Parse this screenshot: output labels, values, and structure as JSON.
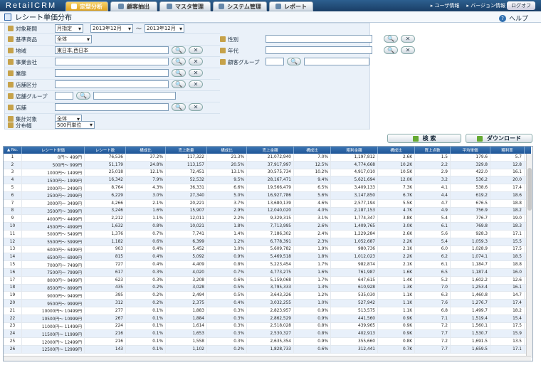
{
  "app": {
    "logo": "RetailCRM"
  },
  "nav": {
    "tabs": [
      {
        "label": "定型分析",
        "active": true
      },
      {
        "label": "顧客抽出",
        "active": false
      },
      {
        "label": "マスタ管理",
        "active": false
      },
      {
        "label": "システム管理",
        "active": false
      },
      {
        "label": "レポート",
        "active": false
      }
    ],
    "links": [
      "▸ ユーザ情報",
      "▸ バージョン情報"
    ],
    "logout": "ログオフ"
  },
  "page": {
    "title": "レシート単価分布",
    "help": "ヘルプ"
  },
  "filters": {
    "period_label": "対象期間",
    "period_mode": "月指定",
    "period_from": "2013年12月",
    "period_sep": "〜",
    "period_to": "2013年12月",
    "base_product_label": "基準商品",
    "base_product": "全体",
    "region_label": "地域",
    "region_value": "東日本,西日本",
    "company_label": "事業会社",
    "format_label": "業態",
    "store_type_label": "店舗区分",
    "store_group_label": "店舗グループ",
    "store_label": "店舗",
    "target_label": "集計対象",
    "target_value": "全体",
    "width_label": "分布幅",
    "width_value": "500円単位",
    "gender_label": "性別",
    "age_label": "年代",
    "customer_group_label": "顧客グループ",
    "search_glyph": "🔍",
    "clear_glyph": "✕"
  },
  "actions": {
    "search": "検 索",
    "download": "ダウンロード"
  },
  "table": {
    "headers": [
      "▲ No.",
      "レシート単価",
      "レシート数",
      "構成比",
      "売上数量",
      "構成比",
      "売上金額",
      "構成比",
      "粗利金額",
      "構成比",
      "買上点数",
      "平均単価",
      "粗利率"
    ],
    "rows": [
      [
        "1",
        "0円～ 499円",
        "76,536",
        "37.2%",
        "117,322",
        "21.3%",
        "21,072,940",
        "7.0%",
        "1,197,812",
        "2.6K",
        "1.5",
        "179.6",
        "5.7"
      ],
      [
        "2",
        "500円～ 999円",
        "51,179",
        "24.8%",
        "113,157",
        "20.5%",
        "37,917,997",
        "12.5%",
        "4,774,668",
        "10.2K",
        "2.2",
        "329.8",
        "12.8"
      ],
      [
        "3",
        "1000円～ 1499円",
        "25,018",
        "12.1%",
        "72,451",
        "13.1%",
        "30,575,734",
        "10.2%",
        "4,917,010",
        "10.5K",
        "2.9",
        "422.0",
        "16.1"
      ],
      [
        "4",
        "1500円～ 1999円",
        "16,342",
        "7.9%",
        "52,532",
        "9.5%",
        "28,167,471",
        "9.4%",
        "5,621,694",
        "12.0K",
        "3.2",
        "536.2",
        "20.0"
      ],
      [
        "5",
        "2000円～ 2499円",
        "8,764",
        "4.3%",
        "36,331",
        "6.6%",
        "19,566,479",
        "6.5%",
        "3,409,133",
        "7.3K",
        "4.1",
        "538.6",
        "17.4"
      ],
      [
        "6",
        "2500円～ 2999円",
        "6,229",
        "3.0%",
        "27,340",
        "5.0%",
        "16,927,786",
        "5.6%",
        "3,147,850",
        "6.7K",
        "4.4",
        "619.2",
        "18.6"
      ],
      [
        "7",
        "3000円～ 3499円",
        "4,266",
        "2.1%",
        "20,221",
        "3.7%",
        "13,680,139",
        "4.6%",
        "2,577,194",
        "5.5K",
        "4.7",
        "676.5",
        "18.8"
      ],
      [
        "8",
        "3500円～ 3999円",
        "3,246",
        "1.6%",
        "15,907",
        "2.9%",
        "12,040,020",
        "4.0%",
        "2,187,153",
        "4.7K",
        "4.9",
        "756.9",
        "18.2"
      ],
      [
        "9",
        "4000円～ 4499円",
        "2,212",
        "1.1%",
        "12,011",
        "2.2%",
        "9,329,315",
        "3.1%",
        "1,774,347",
        "3.8K",
        "5.4",
        "776.7",
        "19.0"
      ],
      [
        "10",
        "4500円～ 4999円",
        "1,632",
        "0.8%",
        "10,021",
        "1.8%",
        "7,713,995",
        "2.6%",
        "1,409,765",
        "3.0K",
        "6.1",
        "769.8",
        "18.3"
      ],
      [
        "11",
        "5000円～ 5499円",
        "1,376",
        "0.7%",
        "7,741",
        "1.4%",
        "7,186,302",
        "2.4%",
        "1,229,284",
        "2.6K",
        "5.6",
        "928.3",
        "17.1"
      ],
      [
        "12",
        "5500円～ 5999円",
        "1,182",
        "0.6%",
        "6,399",
        "1.2%",
        "6,778,391",
        "2.3%",
        "1,052,687",
        "2.2K",
        "5.4",
        "1,059.3",
        "15.5"
      ],
      [
        "13",
        "6000円～ 6499円",
        "903",
        "0.4%",
        "5,452",
        "1.0%",
        "5,609,782",
        "1.9%",
        "980,736",
        "2.1K",
        "6.0",
        "1,028.9",
        "17.5"
      ],
      [
        "14",
        "6500円～ 6999円",
        "815",
        "0.4%",
        "5,092",
        "0.9%",
        "5,469,518",
        "1.8%",
        "1,012,023",
        "2.2K",
        "6.2",
        "1,074.1",
        "18.5"
      ],
      [
        "15",
        "7000円～ 7499円",
        "727",
        "0.4%",
        "4,409",
        "0.8%",
        "5,223,454",
        "1.7%",
        "982,874",
        "2.1K",
        "6.1",
        "1,184.7",
        "18.8"
      ],
      [
        "16",
        "7500円～ 7999円",
        "617",
        "0.3%",
        "4,020",
        "0.7%",
        "4,773,275",
        "1.6%",
        "761,987",
        "1.6K",
        "6.5",
        "1,187.4",
        "16.0"
      ],
      [
        "17",
        "8000円～ 8499円",
        "623",
        "0.3%",
        "3,208",
        "0.6%",
        "5,159,068",
        "1.7%",
        "647,615",
        "1.4K",
        "5.2",
        "1,602.2",
        "12.6"
      ],
      [
        "18",
        "8500円～ 8999円",
        "435",
        "0.2%",
        "3,028",
        "0.5%",
        "3,795,333",
        "1.3%",
        "610,928",
        "1.3K",
        "7.0",
        "1,253.4",
        "16.1"
      ],
      [
        "19",
        "9000円～ 9499円",
        "395",
        "0.2%",
        "2,494",
        "0.5%",
        "3,643,326",
        "1.2%",
        "535,030",
        "1.1K",
        "6.3",
        "1,460.8",
        "14.7"
      ],
      [
        "20",
        "9500円～ 9999円",
        "312",
        "0.2%",
        "2,375",
        "0.4%",
        "3,032,255",
        "1.0%",
        "527,942",
        "1.1K",
        "7.6",
        "1,276.7",
        "17.4"
      ],
      [
        "21",
        "10000円～ 10499円",
        "277",
        "0.1%",
        "1,883",
        "0.3%",
        "2,823,957",
        "0.9%",
        "513,575",
        "1.1K",
        "6.8",
        "1,499.7",
        "18.2"
      ],
      [
        "22",
        "10500円～ 10999円",
        "267",
        "0.1%",
        "1,884",
        "0.3%",
        "2,862,529",
        "0.9%",
        "441,560",
        "0.9K",
        "7.1",
        "1,519.4",
        "15.4"
      ],
      [
        "23",
        "11000円～ 11499円",
        "224",
        "0.1%",
        "1,614",
        "0.3%",
        "2,518,028",
        "0.8%",
        "439,965",
        "0.9K",
        "7.2",
        "1,560.1",
        "17.5"
      ],
      [
        "24",
        "11500円～ 11999円",
        "216",
        "0.1%",
        "1,653",
        "0.3%",
        "2,530,327",
        "0.8%",
        "402,913",
        "0.9K",
        "7.7",
        "1,530.7",
        "15.9"
      ],
      [
        "25",
        "12000円～ 12499円",
        "216",
        "0.1%",
        "1,558",
        "0.3%",
        "2,635,354",
        "0.9%",
        "355,660",
        "0.8K",
        "7.2",
        "1,691.5",
        "13.5"
      ],
      [
        "26",
        "12500円～ 12999円",
        "143",
        "0.1%",
        "1,102",
        "0.2%",
        "1,828,733",
        "0.6%",
        "312,441",
        "0.7K",
        "7.7",
        "1,659.5",
        "17.1"
      ]
    ]
  }
}
